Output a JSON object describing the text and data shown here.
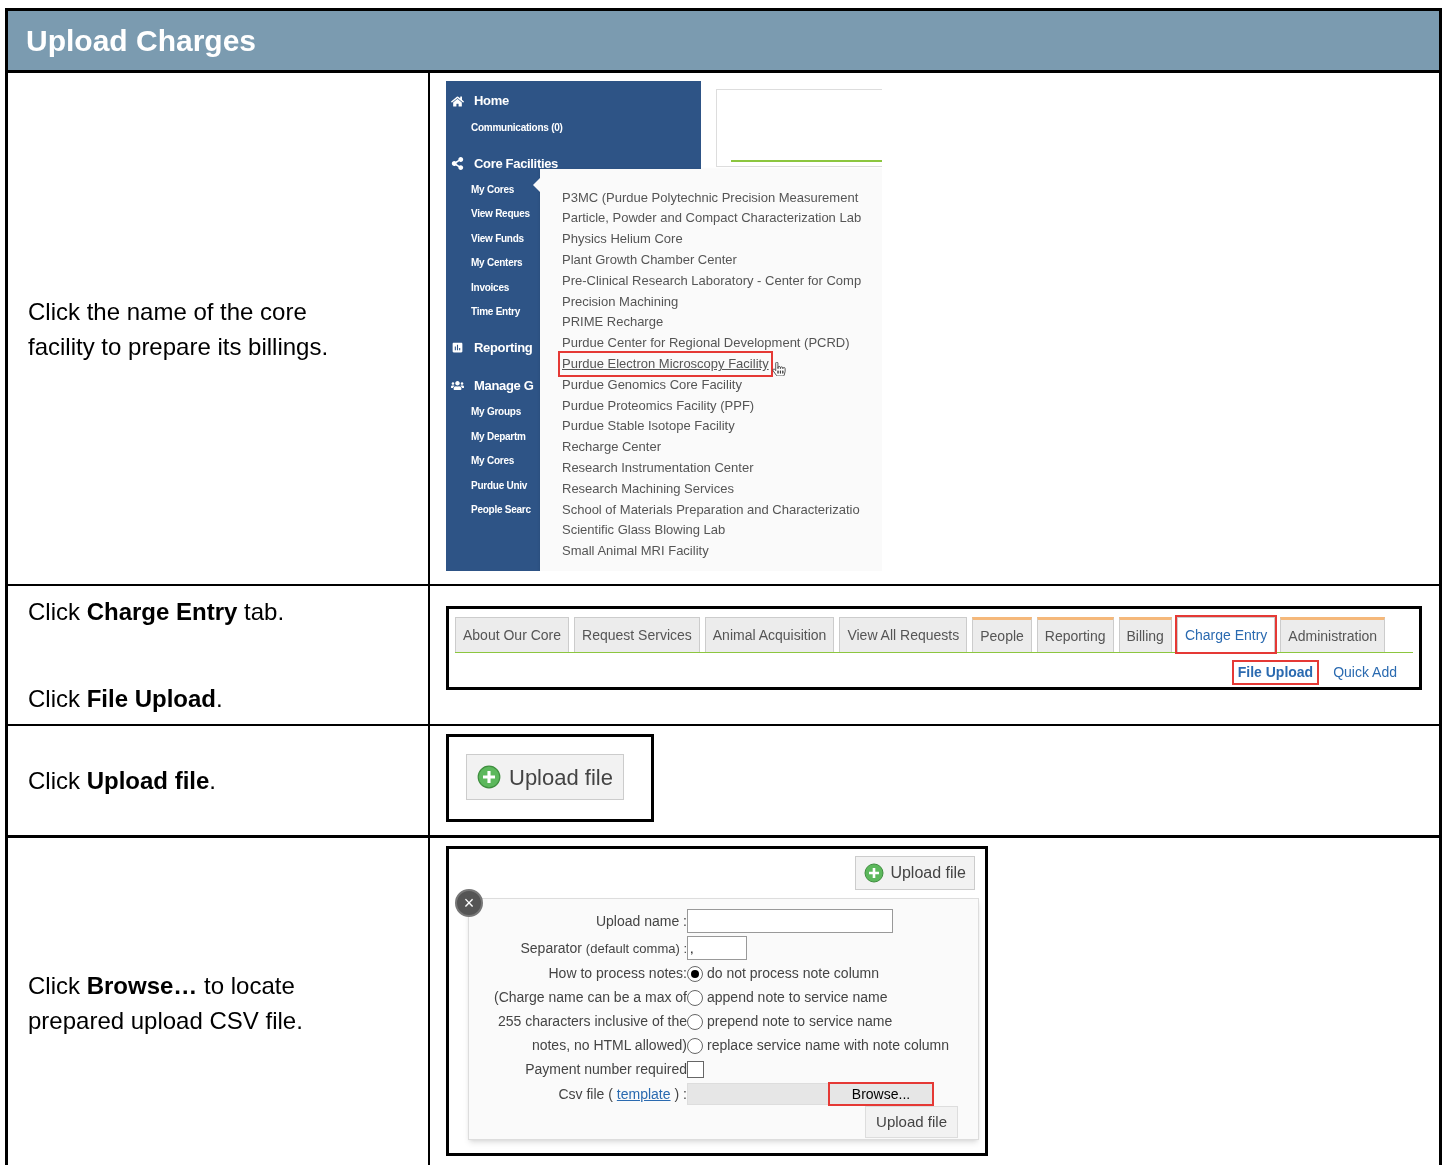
{
  "title": "Upload Charges",
  "steps": [
    {
      "kind": "menu",
      "instructions": [
        "Click the name of the core facility to prepare its billings."
      ],
      "sidebar": [
        {
          "title": "Home",
          "items": [
            "Communications (0)"
          ]
        },
        {
          "title": "Core Facilities",
          "items": [
            "My Cores",
            "View Reques",
            "View Funds",
            "My Centers",
            "Invoices",
            "Time Entry"
          ]
        },
        {
          "title": "Reporting"
        },
        {
          "title": "Manage G",
          "items": [
            "My Groups",
            "My Departm",
            "My Cores",
            "Purdue Univ",
            "People Searc"
          ]
        }
      ],
      "dropdown": [
        {
          "label": "P3MC (Purdue Polytechnic Precision Measurement",
          "selected": false
        },
        {
          "label": "Particle, Powder and Compact Characterization Lab",
          "selected": false
        },
        {
          "label": "Physics Helium Core",
          "selected": false
        },
        {
          "label": "Plant Growth Chamber Center",
          "selected": false
        },
        {
          "label": "Pre-Clinical Research Laboratory - Center for Comp",
          "selected": false
        },
        {
          "label": "Precision Machining",
          "selected": false
        },
        {
          "label": "PRIME Recharge",
          "selected": false
        },
        {
          "label": "Purdue Center for Regional Development (PCRD)",
          "selected": false
        },
        {
          "label": "Purdue Electron Microscopy Facility",
          "selected": true
        },
        {
          "label": "Purdue Genomics Core Facility",
          "selected": false
        },
        {
          "label": "Purdue Proteomics Facility (PPF)",
          "selected": false
        },
        {
          "label": "Purdue Stable Isotope Facility",
          "selected": false
        },
        {
          "label": "Recharge Center",
          "selected": false
        },
        {
          "label": "Research Instrumentation Center",
          "selected": false
        },
        {
          "label": "Research Machining Services",
          "selected": false
        },
        {
          "label": "School of Materials Preparation and Characterizatio",
          "selected": false
        },
        {
          "label": "Scientific Glass Blowing Lab",
          "selected": false
        },
        {
          "label": "Small Animal MRI Facility",
          "selected": false
        }
      ]
    },
    {
      "kind": "tabs",
      "instructions": [
        "Click **Charge Entry** tab.",
        "Click **File Upload**."
      ],
      "tabs": [
        {
          "label": "About Our Core",
          "selected": false,
          "accent": false
        },
        {
          "label": "Request Services",
          "selected": false,
          "accent": false
        },
        {
          "label": "Animal Acquisition",
          "selected": false,
          "accent": false
        },
        {
          "label": "View All Requests",
          "selected": false,
          "accent": false
        },
        {
          "label": "People",
          "selected": false,
          "accent": true
        },
        {
          "label": "Reporting",
          "selected": false,
          "accent": true
        },
        {
          "label": "Billing",
          "selected": false,
          "accent": true
        },
        {
          "label": "Charge Entry",
          "selected": true,
          "accent": false
        },
        {
          "label": "Administration",
          "selected": false,
          "accent": true
        }
      ],
      "subtabs": [
        {
          "label": "File Upload",
          "selected": true
        },
        {
          "label": "Quick Add",
          "selected": false
        }
      ]
    },
    {
      "kind": "button",
      "instructions": [
        "Click **Upload file**."
      ],
      "button": "Upload file"
    },
    {
      "kind": "form",
      "instructions": [
        "Click **Browse…** to locate prepared upload CSV file."
      ],
      "top_button": "Upload file",
      "close": "×",
      "upload_name_label": "Upload name :",
      "separator_label": "Separator",
      "separator_hint": "(default comma) :",
      "separator": ",",
      "notes_label_lines": [
        "How to process notes:",
        "(Charge name can be a max of",
        "255 characters inclusive of the",
        "notes, no HTML allowed)"
      ],
      "notes_options": [
        {
          "label": "do not process note column",
          "selected": true
        },
        {
          "label": "append note to service name",
          "selected": false
        },
        {
          "label": "prepend note to service name",
          "selected": false
        },
        {
          "label": "replace service name with note column",
          "selected": false
        }
      ],
      "payment_label": "Payment number required",
      "payment_checked": false,
      "csv_label_before": "Csv file (",
      "csv_link": "template",
      "csv_label_after": ") :",
      "browse": "Browse...",
      "submit": "Upload file"
    }
  ]
}
